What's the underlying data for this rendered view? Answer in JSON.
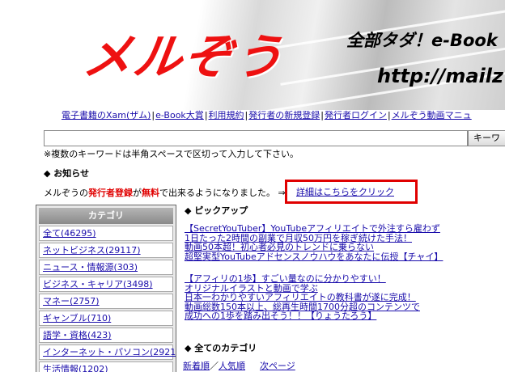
{
  "banner": {
    "logo_text": "メルぞう",
    "tagline": "全部タダ！e-Book",
    "url": "http://mailz"
  },
  "topnav": {
    "items": [
      "電子書籍のXam(ザム)",
      "e-Book大賞",
      "利用規約",
      "発行者の新規登録",
      "発行者ログイン",
      "メルぞう動画マニュ"
    ],
    "separator": "|"
  },
  "search": {
    "input_value": "",
    "button_label": "キーワ",
    "note": "※複数のキーワードは半角スペースで区切って入力して下さい。"
  },
  "notice": {
    "heading": "◆ お知らせ",
    "text_1": "メルぞうの",
    "highlight_1": "発行者登録",
    "text_2": "が",
    "highlight_2": "無料",
    "text_3": "で出来るようになりました。 ⇒",
    "detail_link": "詳細はこちらをクリック",
    "accent_color": "#e00000"
  },
  "categories": {
    "header": "カテゴリ",
    "items": [
      "全て(46295)",
      "ネットビジネス(29117)",
      "ニュース・情報源(303)",
      "ビジネス・キャリア(3498)",
      "マネー(2757)",
      "ギャンブル(710)",
      "語学・資格(423)",
      "インターネット・パソコン(2921)",
      "生活情報(1202)"
    ]
  },
  "pickup": {
    "heading": "◆ ピックアップ",
    "group_1": [
      "【SecretYouTuber】YouTubeアフィリエイトで外注すら雇わず",
      "1日たった2時間の副業で月収50万円を稼ぎ続けた手法！",
      "動画50本超！初心者必見のトレンドに乗らない",
      "超堅実型YouTubeアドセンスノウハウをあなたに伝授【チャイ】"
    ],
    "group_2": [
      "【アフィリの1歩】すごい量なのに分かりやすい！",
      "オリジナルイラストと動画で学ぶ",
      "日本一わかりやすいアフィリエイトの教科書が遂に完成！",
      "動画総数150本以上、総再生時間1700分超のコンテンツで",
      "成功への1歩を踏み出そう！！【りょうたろう】"
    ]
  },
  "all_categories": {
    "heading": "◆ 全てのカテゴリ",
    "sort_new": "新着順",
    "sort_sep": "／",
    "sort_popular": "人気順",
    "next_page": "次ページ"
  }
}
